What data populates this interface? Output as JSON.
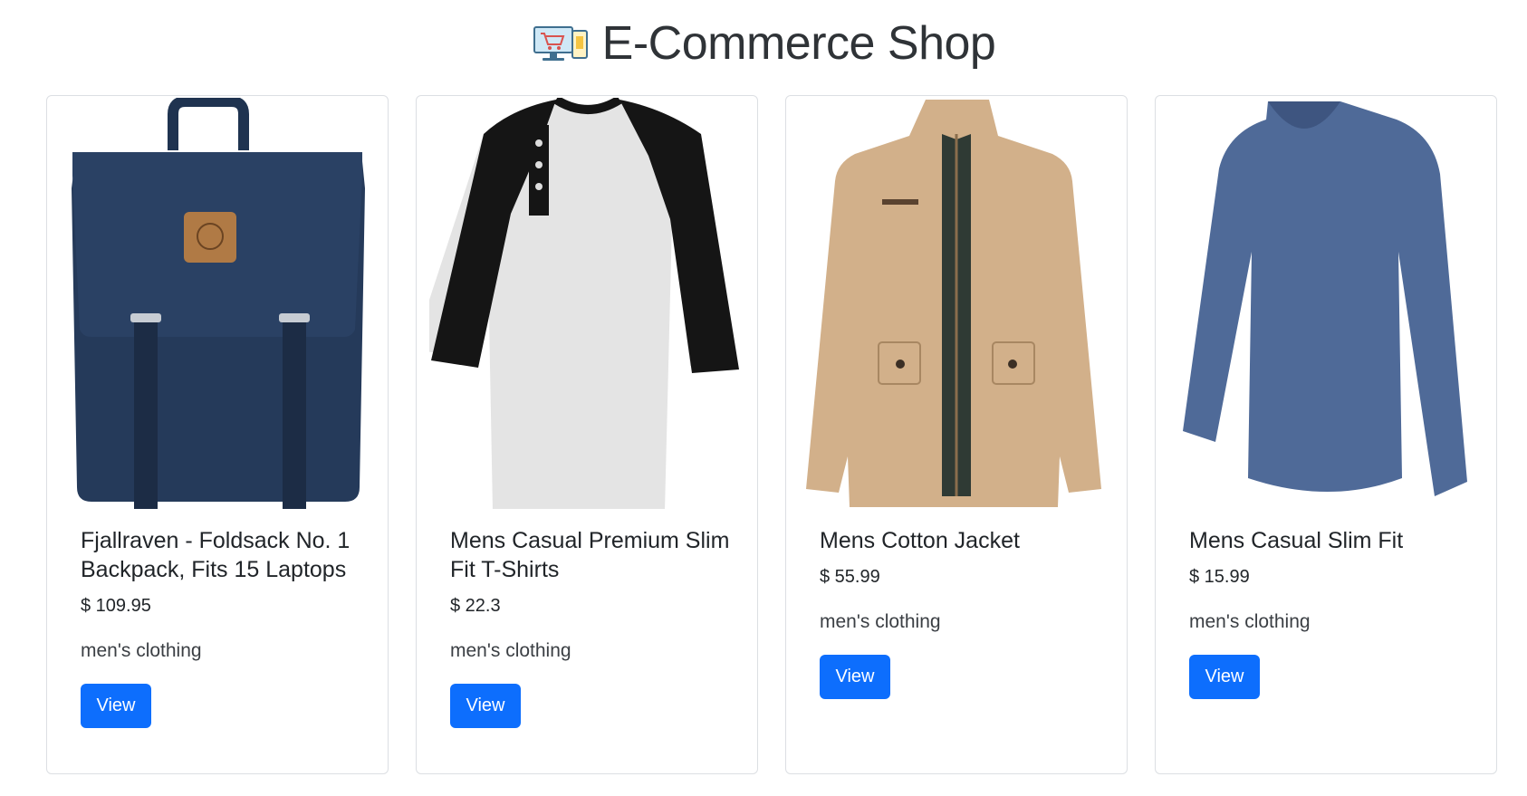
{
  "header": {
    "title": "E-Commerce Shop",
    "logo_icon": "shopping-cart-devices-icon"
  },
  "colors": {
    "primary_button": "#0d6efd",
    "card_border": "#dcdfe3",
    "text": "#212529"
  },
  "products": [
    {
      "title": "Fjallraven - Foldsack No. 1 Backpack, Fits 15 Laptops",
      "price": "$ 109.95",
      "category": "men's clothing",
      "button_label": "View",
      "image_icon": "backpack-image"
    },
    {
      "title": "Mens Casual Premium Slim Fit T-Shirts",
      "price": "$ 22.3",
      "category": "men's clothing",
      "button_label": "View",
      "image_icon": "raglan-tshirt-image"
    },
    {
      "title": "Mens Cotton Jacket",
      "price": "$ 55.99",
      "category": "men's clothing",
      "button_label": "View",
      "image_icon": "cotton-jacket-image"
    },
    {
      "title": "Mens Casual Slim Fit",
      "price": "$ 15.99",
      "category": "men's clothing",
      "button_label": "View",
      "image_icon": "longsleeve-shirt-image"
    }
  ]
}
